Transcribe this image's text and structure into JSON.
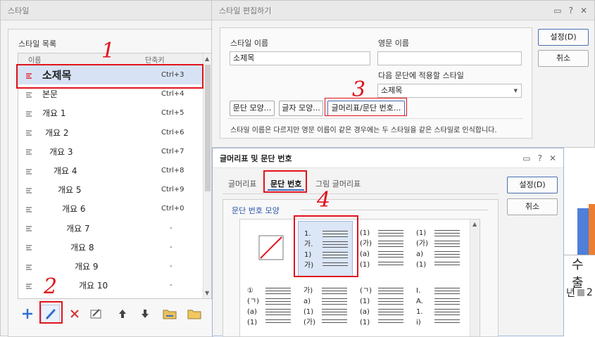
{
  "style_window": {
    "title": "스타일",
    "list_title": "스타일 목록",
    "col_name": "이름",
    "col_key": "단축키",
    "rows": [
      {
        "name": "소제목",
        "key": "Ctrl+3"
      },
      {
        "name": "본문",
        "key": "Ctrl+4"
      },
      {
        "name": "개요 1",
        "key": "Ctrl+5"
      },
      {
        "name": "개요 2",
        "key": "Ctrl+6"
      },
      {
        "name": "개요 3",
        "key": "Ctrl+7"
      },
      {
        "name": "개요 4",
        "key": "Ctrl+8"
      },
      {
        "name": "개요 5",
        "key": "Ctrl+9"
      },
      {
        "name": "개요 6",
        "key": "Ctrl+0"
      },
      {
        "name": "개요 7",
        "key": "-"
      },
      {
        "name": "개요 8",
        "key": "-"
      },
      {
        "name": "개요 9",
        "key": "-"
      },
      {
        "name": "개요 10",
        "key": "-"
      }
    ]
  },
  "edit_window": {
    "title": "스타일 편집하기",
    "name_label": "스타일 이름",
    "name_value": "소제목",
    "eng_label": "영문 이름",
    "eng_value": "",
    "next_label": "다음 문단에 적용할 스타일",
    "next_value": "소제목",
    "btn_para": "문단 모양...",
    "btn_char": "글자 모양...",
    "btn_bullet": "글머리표/문단 번호...",
    "note": "스타일 이름은 다르지만 영문 이름이 같은 경우에는 두 스타일을 같은 스타일로 인식합니다.",
    "ok": "설정(D)",
    "cancel": "취소"
  },
  "bullet_window": {
    "title": "글머리표 및 문단 번호",
    "tabs": [
      "글머리표",
      "문단 번호",
      "그림 글머리표"
    ],
    "section": "문단 번호 모양",
    "ok": "설정(D)",
    "cancel": "취소",
    "cells": [
      [
        "1.",
        "가.",
        "1)",
        "가)"
      ],
      [
        "(1)",
        "(가)",
        "(a)",
        "(1)"
      ],
      [
        "(1)",
        "(가)",
        "a)",
        "(1)"
      ],
      [
        "①",
        "(ㄱ)",
        "(a)",
        "(1)"
      ],
      [
        "가)",
        "a)",
        "(1)",
        "(가)"
      ],
      [
        "(ㄱ)",
        "(1)",
        "(a)",
        "(1)"
      ],
      [
        "I.",
        "A.",
        "1.",
        "i)"
      ]
    ]
  },
  "annotations": [
    "1",
    "2",
    "3",
    "4"
  ],
  "background": {
    "text1": "수출",
    "text2": "년",
    "text3": "2"
  },
  "colors": {
    "highlight": "#e0141c",
    "selected_row": "#d7e3f5",
    "bar_blue": "#4f7fd8",
    "bar_orange": "#ed7d31"
  },
  "icons": [
    "close-icon",
    "help-icon",
    "minimize-icon",
    "style-icon",
    "add-icon",
    "edit-icon",
    "delete-icon",
    "copy-icon",
    "up-icon",
    "down-icon",
    "folder-icon",
    "open-folder-icon",
    "scroll-up-icon",
    "scroll-down-icon",
    "no-number-icon"
  ]
}
